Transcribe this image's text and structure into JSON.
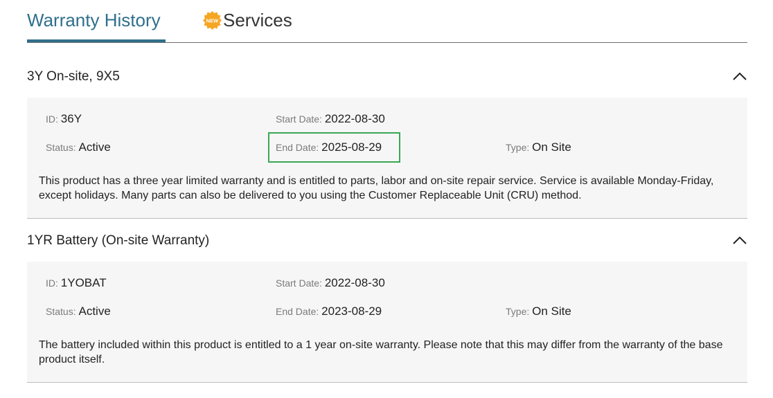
{
  "tabs": {
    "warranty_history": "Warranty History",
    "services": "Services",
    "new_badge": "NEW"
  },
  "colors": {
    "tab_active": "#2f6f8c",
    "highlight_border": "#3aa655",
    "badge": "#f5a623"
  },
  "warranties": [
    {
      "title": "3Y On-site, 9X5",
      "id_label": "ID",
      "id_value": "36Y",
      "start_label": "Start Date",
      "start_value": "2022-08-30",
      "status_label": "Status",
      "status_value": "Active",
      "end_label": "End Date",
      "end_value": "2025-08-29",
      "type_label": "Type",
      "type_value": "On Site",
      "description": "This product has a three year limited warranty and is entitled to parts, labor and on-site repair service. Service is available Monday-Friday, except holidays. Many parts can also be delivered to you using the Customer Replaceable Unit (CRU) method."
    },
    {
      "title": "1YR Battery (On-site Warranty)",
      "id_label": "ID",
      "id_value": "1YOBAT",
      "start_label": "Start Date",
      "start_value": "2022-08-30",
      "status_label": "Status",
      "status_value": "Active",
      "end_label": "End Date",
      "end_value": "2023-08-29",
      "type_label": "Type",
      "type_value": "On Site",
      "description": "The battery included within this product is entitled to a 1 year on-site warranty. Please note that this may differ from the warranty of the base product itself."
    }
  ],
  "icons": {
    "collapse": "chevron-up-icon",
    "badge": "new-badge-icon"
  }
}
